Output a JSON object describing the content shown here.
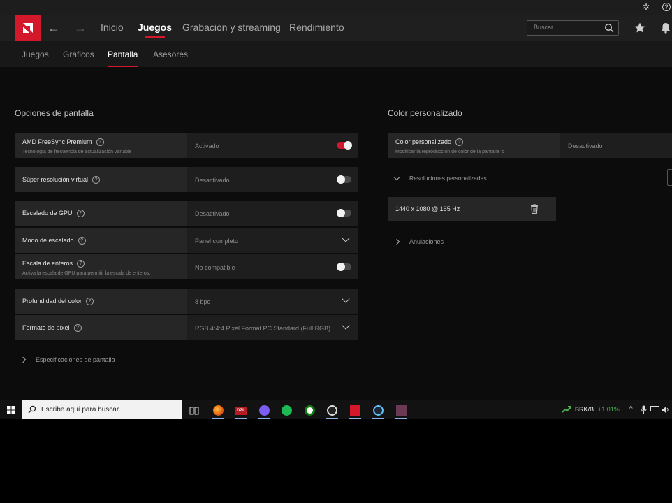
{
  "header": {
    "tabs": [
      {
        "label": "Inicio"
      },
      {
        "label": "Juegos"
      },
      {
        "label": "Grabación y streaming"
      },
      {
        "label": "Rendimiento"
      }
    ],
    "search_placeholder": "Buscar"
  },
  "subtabs": [
    {
      "label": "Juegos"
    },
    {
      "label": "Gráficos"
    },
    {
      "label": "Pantalla"
    },
    {
      "label": "Asesores"
    }
  ],
  "display_options": {
    "title": "Opciones de pantalla",
    "rows": [
      {
        "label": "AMD FreeSync Premium",
        "desc": "Tecnología de frecuencia de actualización variable",
        "value": "Activado"
      },
      {
        "label": "Súper resolución virtual",
        "value": "Desactivado"
      },
      {
        "label": "Escalado de GPU",
        "value": "Desactivado"
      },
      {
        "label": "Modo de escalado",
        "value": "Panel completo"
      },
      {
        "label": "Escala de enteros",
        "desc": "Activa la escala de GPU para permitir la escala de enteros.",
        "value": "No compatible"
      },
      {
        "label": "Profundidad del color",
        "value": "8 bpc"
      },
      {
        "label": "Formato de píxel",
        "value": "RGB 4:4:4 Pixel Format PC Standard (Full RGB)"
      }
    ],
    "specs_link": "Especificaciones de pantalla"
  },
  "custom_color": {
    "title": "Color personalizado",
    "row": {
      "label": "Color personalizado",
      "desc": "Modificar la reproducción de color de la pantalla 's",
      "value": "Desactivado"
    },
    "resolutions_label": "Resoluciones personalizadas",
    "resolution_entry": "1440 x 1080 @ 165 Hz",
    "overrides_label": "Anulaciones"
  },
  "taskbar": {
    "search_placeholder": "Escribe aquí para buscar.",
    "stock_symbol": "BRK/B",
    "stock_change": "+1.01%",
    "colors": {
      "accent": "#d2182a",
      "stock_up": "#4caf50"
    }
  }
}
